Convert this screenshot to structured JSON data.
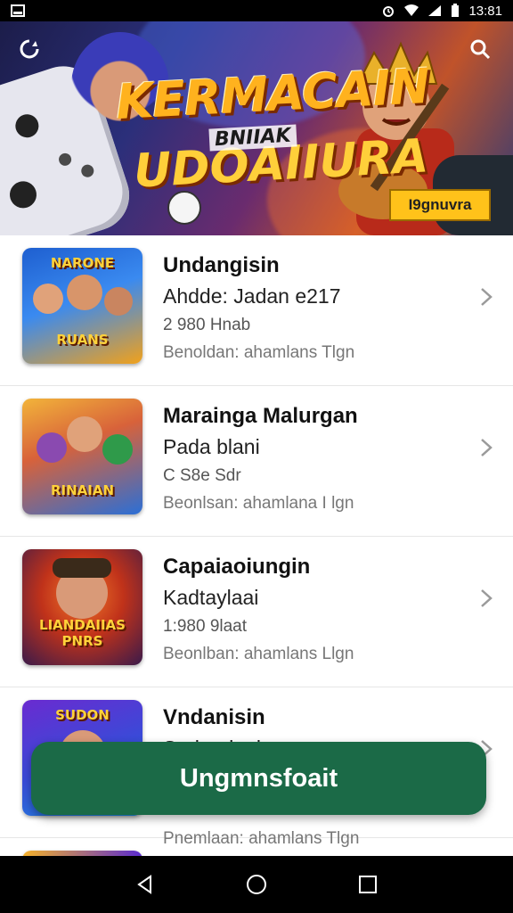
{
  "status_bar": {
    "time": "13:81",
    "icons": [
      "image-icon",
      "alarm-icon",
      "wifi-icon",
      "signal-icon",
      "battery-icon"
    ]
  },
  "banner": {
    "title_line1": "KERMACAIN",
    "title_small": "BNIIAK",
    "title_line2": "UDOAIIURA",
    "cta_label": "I9gnuvra",
    "colors": {
      "title": "#ffb21e",
      "cta": "#ffc21a"
    }
  },
  "list": {
    "items": [
      {
        "title": "Undangisin",
        "subtitle": "Ahdde: Jadan e217",
        "meta": "2 980 Hnab",
        "footer": "Benoldan: ahamlans Tlgn",
        "thumb_top": "NARONE",
        "thumb_label": "RUANS",
        "thumb_colors": [
          "#1e5fd0",
          "#f1a11b"
        ]
      },
      {
        "title": "Marainga Malurgan",
        "subtitle": "Pada blani",
        "meta": "C S8e Sdr",
        "footer": "Beonlsan: ahamlana I lgn",
        "thumb_top": "",
        "thumb_label": "RINAIAN",
        "thumb_colors": [
          "#f2b43a",
          "#2b6fd6"
        ]
      },
      {
        "title": "Capaiaoiungin",
        "subtitle": "Kadtaylaai",
        "meta": "1:980 9laat",
        "footer": "Beonlban: ahamlans Llgn",
        "thumb_top": "",
        "thumb_label": "LIANDAIIAS PNRS",
        "thumb_colors": [
          "#e0431e",
          "#3a1a4a"
        ]
      },
      {
        "title": "Vndanisin",
        "subtitle": "Sadeadaal",
        "meta": "",
        "footer": "",
        "thumb_top": "SUDON",
        "thumb_label": "",
        "thumb_colors": [
          "#6a2bd0",
          "#1a8fe0"
        ]
      },
      {
        "title": "",
        "subtitle": "",
        "meta": "",
        "footer": "Pnemlaan: ahamlans Tlgn",
        "thumb_top": "",
        "thumb_label": "",
        "thumb_colors": [
          "#f5b12a",
          "#5a2bd0"
        ]
      }
    ]
  },
  "fab": {
    "label": "Ungmnsfoait",
    "color": "#1b6a47"
  },
  "nav_bar": {
    "icons": [
      "back-icon",
      "home-icon",
      "recents-icon"
    ]
  }
}
